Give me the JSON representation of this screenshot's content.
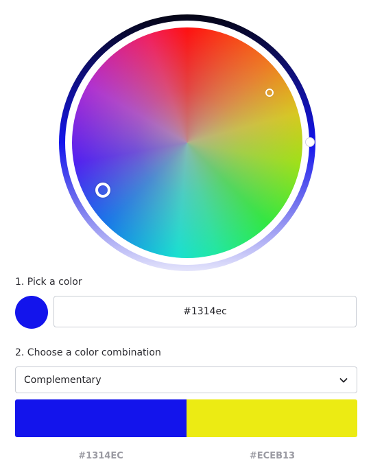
{
  "picker": {
    "step1_label": "1. Pick a color",
    "hex_value": "#1314ec",
    "selected_color": "#1314ec"
  },
  "combination": {
    "step2_label": "2. Choose a color combination",
    "selected": "Complementary"
  },
  "palette": [
    {
      "hex": "#1314EC",
      "color": "#1314ec"
    },
    {
      "hex": "#ECEB13",
      "color": "#eceb13"
    }
  ],
  "icons": {
    "dropdown": "chevron-down-icon"
  }
}
